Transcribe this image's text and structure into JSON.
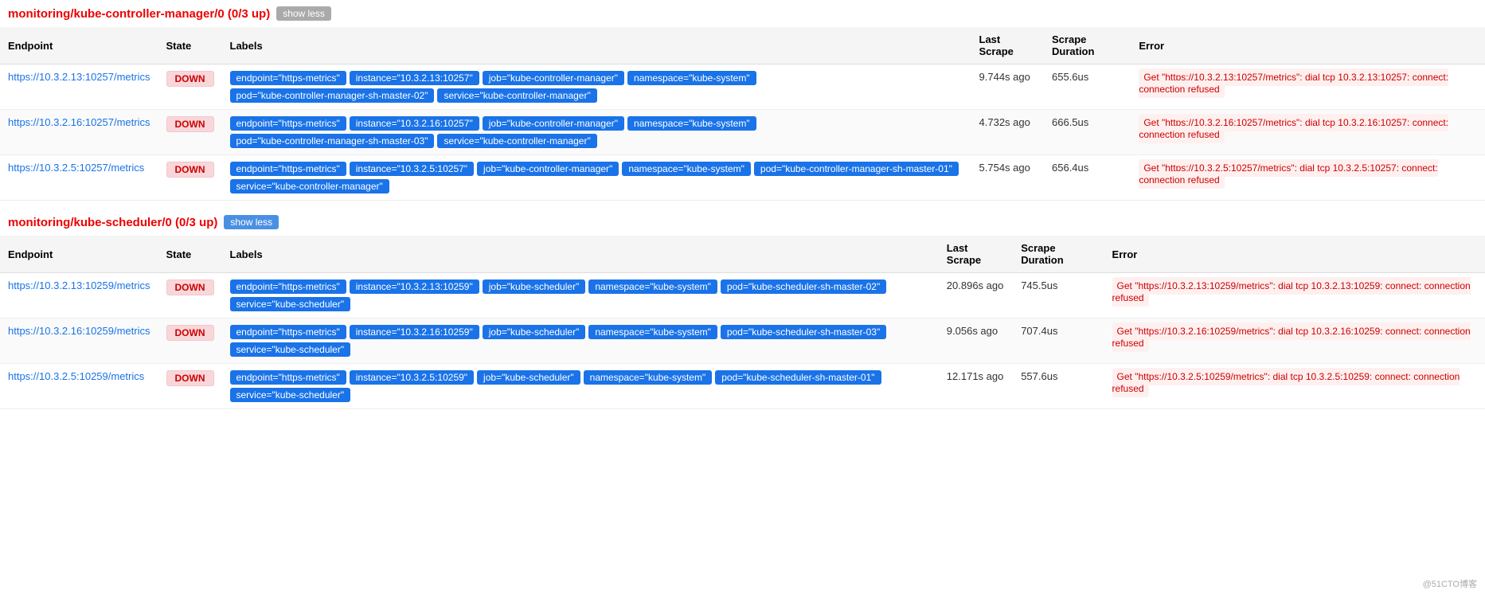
{
  "sections": [
    {
      "id": "kube-controller-manager",
      "title": "monitoring/kube-controller-manager/0 (0/3 up)",
      "showLessLabel": "show less",
      "showLessStyle": "gray",
      "columns": {
        "endpoint": "Endpoint",
        "state": "State",
        "labels": "Labels",
        "lastScrape": "Last Scrape",
        "scrapeDuration": "Scrape Duration",
        "error": "Error"
      },
      "rows": [
        {
          "endpoint": "https://10.3.2.13:10257/metrics",
          "state": "DOWN",
          "labels": [
            "endpoint=\"https-metrics\"",
            "instance=\"10.3.2.13:10257\"",
            "job=\"kube-controller-manager\"",
            "namespace=\"kube-system\"",
            "pod=\"kube-controller-manager-sh-master-02\"",
            "service=\"kube-controller-manager\""
          ],
          "lastScrape": "9.744s ago",
          "scrapeDuration": "655.6us",
          "error": "Get \"https://10.3.2.13:10257/metrics\": dial tcp 10.3.2.13:10257: connect: connection refused"
        },
        {
          "endpoint": "https://10.3.2.16:10257/metrics",
          "state": "DOWN",
          "labels": [
            "endpoint=\"https-metrics\"",
            "instance=\"10.3.2.16:10257\"",
            "job=\"kube-controller-manager\"",
            "namespace=\"kube-system\"",
            "pod=\"kube-controller-manager-sh-master-03\"",
            "service=\"kube-controller-manager\""
          ],
          "lastScrape": "4.732s ago",
          "scrapeDuration": "666.5us",
          "error": "Get \"https://10.3.2.16:10257/metrics\": dial tcp 10.3.2.16:10257: connect: connection refused"
        },
        {
          "endpoint": "https://10.3.2.5:10257/metrics",
          "state": "DOWN",
          "labels": [
            "endpoint=\"https-metrics\"",
            "instance=\"10.3.2.5:10257\"",
            "job=\"kube-controller-manager\"",
            "namespace=\"kube-system\"",
            "pod=\"kube-controller-manager-sh-master-01\"",
            "service=\"kube-controller-manager\""
          ],
          "lastScrape": "5.754s ago",
          "scrapeDuration": "656.4us",
          "error": "Get \"https://10.3.2.5:10257/metrics\": dial tcp 10.3.2.5:10257: connect: connection refused"
        }
      ]
    },
    {
      "id": "kube-scheduler",
      "title": "monitoring/kube-scheduler/0 (0/3 up)",
      "showLessLabel": "show less",
      "showLessStyle": "blue",
      "columns": {
        "endpoint": "Endpoint",
        "state": "State",
        "labels": "Labels",
        "lastScrape": "Last Scrape",
        "scrapeDuration": "Scrape Duration",
        "error": "Error"
      },
      "rows": [
        {
          "endpoint": "https://10.3.2.13:10259/metrics",
          "state": "DOWN",
          "labels": [
            "endpoint=\"https-metrics\"",
            "instance=\"10.3.2.13:10259\"",
            "job=\"kube-scheduler\"",
            "namespace=\"kube-system\"",
            "pod=\"kube-scheduler-sh-master-02\"",
            "service=\"kube-scheduler\""
          ],
          "lastScrape": "20.896s ago",
          "scrapeDuration": "745.5us",
          "error": "Get \"https://10.3.2.13:10259/metrics\": dial tcp 10.3.2.13:10259: connect: connection refused"
        },
        {
          "endpoint": "https://10.3.2.16:10259/metrics",
          "state": "DOWN",
          "labels": [
            "endpoint=\"https-metrics\"",
            "instance=\"10.3.2.16:10259\"",
            "job=\"kube-scheduler\"",
            "namespace=\"kube-system\"",
            "pod=\"kube-scheduler-sh-master-03\"",
            "service=\"kube-scheduler\""
          ],
          "lastScrape": "9.056s ago",
          "scrapeDuration": "707.4us",
          "error": "Get \"https://10.3.2.16:10259/metrics\": dial tcp 10.3.2.16:10259: connect: connection refused"
        },
        {
          "endpoint": "https://10.3.2.5:10259/metrics",
          "state": "DOWN",
          "labels": [
            "endpoint=\"https-metrics\"",
            "instance=\"10.3.2.5:10259\"",
            "job=\"kube-scheduler\"",
            "namespace=\"kube-system\"",
            "pod=\"kube-scheduler-sh-master-01\"",
            "service=\"kube-scheduler\""
          ],
          "lastScrape": "12.171s ago",
          "scrapeDuration": "557.6us",
          "error": "Get \"https://10.3.2.5:10259/metrics\": dial tcp 10.3.2.5:10259: connect: connection refused"
        }
      ]
    }
  ],
  "watermark": "@51CTO博客"
}
